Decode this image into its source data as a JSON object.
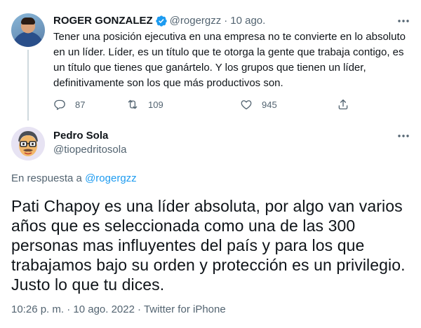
{
  "parent_tweet": {
    "author_name": "ROGER GONZALEZ",
    "author_handle": "@rogergzz",
    "separator": "·",
    "time": "10 ago.",
    "text": "Tener una posición ejecutiva en una empresa no te convierte en lo absoluto en un líder. Líder, es un título que te otorga la gente que trabaja contigo, es un título que tienes que ganártelo. Y los grupos que tienen un líder, definitivamente son los que más productivos son.",
    "reply_count": "87",
    "retweet_count": "109",
    "like_count": "945",
    "icons": {
      "verified": "verified-badge-icon",
      "more": "more-icon",
      "reply": "reply-icon",
      "retweet": "retweet-icon",
      "like": "like-icon",
      "share": "share-icon"
    }
  },
  "main_tweet": {
    "author_name": "Pedro Sola",
    "author_handle": "@tiopedritosola",
    "reply_prefix": "En respuesta a",
    "reply_handle": "@rogergzz",
    "text": "Pati Chapoy es una líder absoluta, por algo van varios años que es seleccionada como una de las 300 personas mas influyentes del país y para los que trabajamos bajo su orden y protección es un privilegio. Justo lo que tu dices.",
    "timestamp": "10:26 p. m. · 10 ago. 2022",
    "meta_separator": "·",
    "source": "Twitter for iPhone"
  },
  "colors": {
    "text": "#0f1419",
    "secondary": "#536471",
    "accent": "#1d9bf0",
    "retweet_icon": "#536471",
    "thread_line": "#cfd9de"
  }
}
